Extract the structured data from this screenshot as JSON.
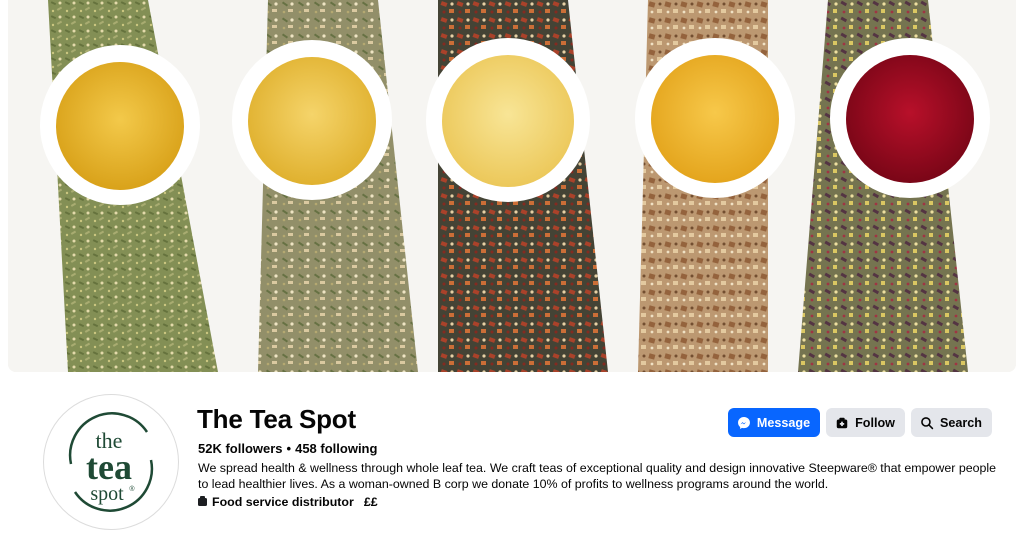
{
  "cover": {
    "alt_subject": "cover-photo-tea-cups"
  },
  "profile": {
    "name": "The Tea Spot",
    "followers": "52K followers",
    "following": "458 following",
    "separator": "•",
    "bio": "We spread health & wellness through whole leaf tea. We craft teas of exceptional quality and design innovative Steepware® that empower people to lead healthier lives. As a woman-owned B corp we donate 10% of profits to wellness programs around the world.",
    "category": "Food service distributor",
    "price_range": "££",
    "logo": {
      "word1": "the",
      "word2": "tea",
      "word3": "spot",
      "mark": "®"
    }
  },
  "actions": {
    "message_label": "Message",
    "follow_label": "Follow",
    "search_label": "Search"
  },
  "colors": {
    "accent": "#0866ff",
    "secondary_button": "#e4e6eb",
    "logo_green": "#1f4a35"
  }
}
